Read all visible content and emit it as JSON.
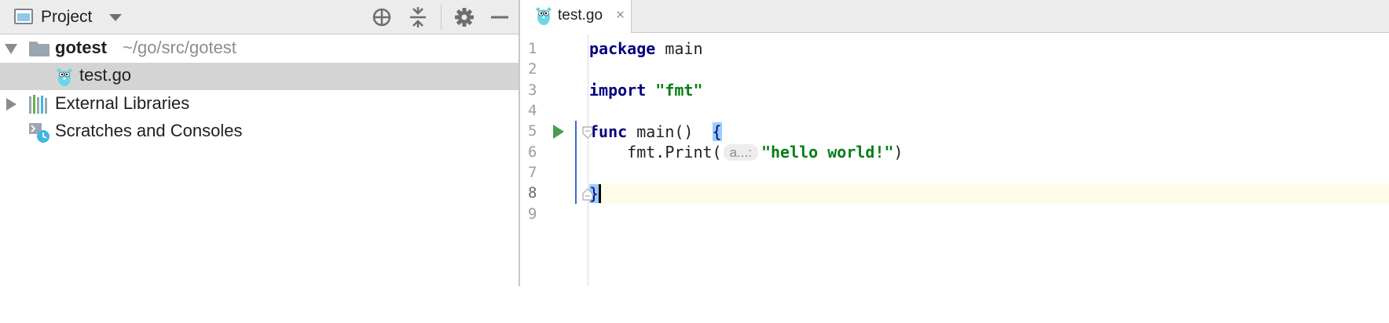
{
  "project_panel": {
    "title": "Project",
    "tree": {
      "root": {
        "name": "gotest",
        "path": "~/go/src/gotest"
      },
      "file": {
        "name": "test.go"
      },
      "libraries": {
        "name": "External Libraries"
      },
      "scratches": {
        "name": "Scratches and Consoles"
      }
    }
  },
  "editor": {
    "tab": {
      "label": "test.go",
      "close": "×"
    },
    "line_numbers": [
      "1",
      "2",
      "3",
      "4",
      "5",
      "6",
      "7",
      "8",
      "9"
    ],
    "code": {
      "l1_kw": "package",
      "l1_rest": " main",
      "l3_kw": "import",
      "l3_str": "\"fmt\"",
      "l5_kw": "func",
      "l5_rest": " main()  ",
      "l5_brace": "{",
      "l6_indent": "    ",
      "l6_call": "fmt.Print(",
      "l6_hint": "a...:",
      "l6_str": "\"hello world!\"",
      "l6_close": ")",
      "l8_brace": "}"
    }
  },
  "colors": {
    "keyword": "#000080",
    "string": "#067d17",
    "current_line": "#fefbe8",
    "selection": "#d4d4d4",
    "run_icon": "#499c54"
  },
  "icons": [
    "project-view-icon",
    "dropdown-icon",
    "locate-icon",
    "collapse-all-icon",
    "gear-icon",
    "minimize-icon",
    "expand-arrow-icon",
    "collapse-arrow-icon",
    "folder-icon",
    "gopher-icon",
    "library-icon",
    "scratch-icon",
    "close-icon",
    "run-icon",
    "fold-icon"
  ]
}
